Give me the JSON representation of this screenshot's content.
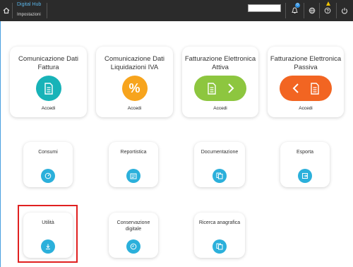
{
  "header": {
    "app_title": "Digital Hub",
    "subtitle": "Impostazioni",
    "search_value": "",
    "notification_count": "0"
  },
  "main_tiles": [
    {
      "title": "Comunicazione Dati Fattura",
      "action": "Accedi",
      "icon": "document-icon",
      "color": "#18b3b8"
    },
    {
      "title": "Comunicazione Dati Liquidazioni IVA",
      "action": "Accedi",
      "icon": "percent-icon",
      "color": "#f7a41d"
    },
    {
      "title": "Fatturazione Elettronica Attiva",
      "action": "Accedi",
      "icon": "document-arrow-right-icon",
      "color": "#8dc63f"
    },
    {
      "title": "Fatturazione Elettronica Passiva",
      "action": "Accedi",
      "icon": "arrow-left-document-icon",
      "color": "#f26522"
    }
  ],
  "tool_tiles": [
    {
      "title": "Consumi",
      "icon": "gauge-icon"
    },
    {
      "title": "Reportistica",
      "icon": "report-icon"
    },
    {
      "title": "Documentazione",
      "icon": "documents-icon"
    },
    {
      "title": "Esporta",
      "icon": "export-icon"
    },
    {
      "title": "Utilità",
      "icon": "download-icon"
    },
    {
      "title": "Conservazione digitale",
      "icon": "archive-clock-icon"
    },
    {
      "title": "Ricerca anagrafica",
      "icon": "documents-icon"
    }
  ],
  "colors": {
    "topbar": "#2b2b2b",
    "accent": "#5ab3e6",
    "tool_icon": "#2bb0db",
    "highlight": "#e02020"
  }
}
